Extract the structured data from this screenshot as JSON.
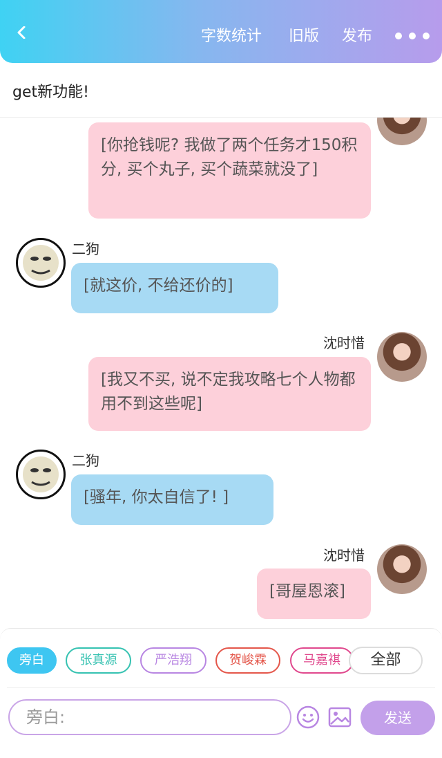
{
  "header": {
    "stats_label": "字数统计",
    "old_version_label": "旧版",
    "publish_label": "发布"
  },
  "title": "get新功能!",
  "messages": [
    {
      "side": "right",
      "name": "",
      "text": "[你抢钱呢? 我做了两个任务才150积分, 买个丸子, 买个蔬菜就没了]",
      "color": "#fdd0da"
    },
    {
      "side": "left",
      "name": "二狗",
      "text": "[就这价, 不给还价的]",
      "color": "#a7daf4"
    },
    {
      "side": "right",
      "name": "沈时惜",
      "text": "[我又不买, 说不定我攻略七个人物都用不到这些呢]",
      "color": "#fdd0da"
    },
    {
      "side": "left",
      "name": "二狗",
      "text": "[骚年, 你太自信了! ]",
      "color": "#a7daf4"
    },
    {
      "side": "right",
      "name": "沈时惜",
      "text": "[哥屋恩滚]",
      "color": "#fdd0da"
    }
  ],
  "roles": [
    {
      "label": "旁白",
      "color": "#3ec6f1",
      "selected": true
    },
    {
      "label": "张真源",
      "color": "#35c2b1",
      "selected": false
    },
    {
      "label": "严浩翔",
      "color": "#b886e2",
      "selected": false
    },
    {
      "label": "贺峻霖",
      "color": "#e4564a",
      "selected": false
    },
    {
      "label": "马嘉祺",
      "color": "#e0488d",
      "selected": false
    }
  ],
  "all_label": "全部",
  "input": {
    "placeholder": "旁白:"
  },
  "send_label": "发送",
  "icons": {
    "back": "chevron-left-icon",
    "more": "more-dots-icon",
    "emoji": "emoji-icon",
    "image": "image-icon"
  }
}
